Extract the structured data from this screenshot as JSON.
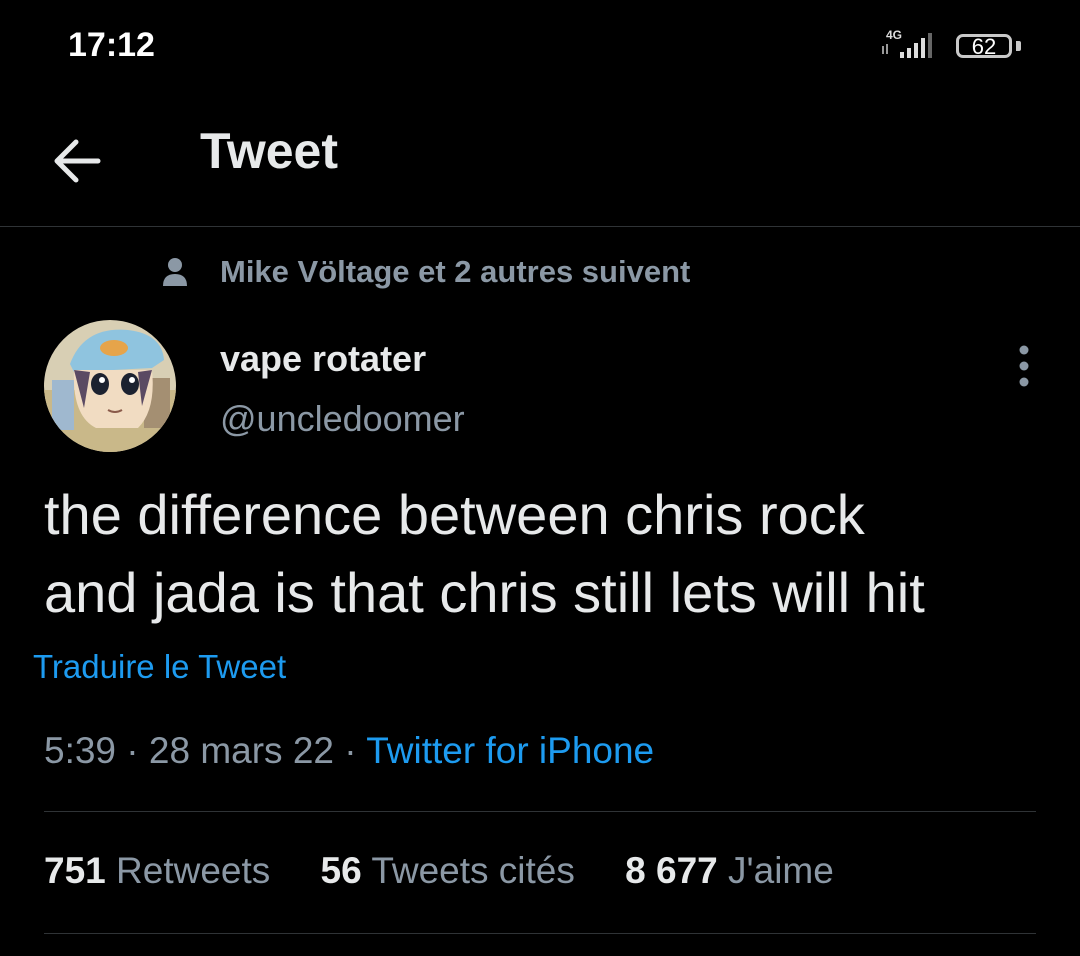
{
  "status_bar": {
    "time": "17:12",
    "network": "4G",
    "battery": "62",
    "icons": [
      "signal-icon",
      "battery-icon"
    ]
  },
  "header": {
    "title": "Tweet",
    "back_icon": "arrow-left-icon"
  },
  "tweet": {
    "social_context": "Mike Völtage et 2 autres suivent",
    "author_name": "vape rotater",
    "author_handle": "@uncledoomer",
    "text_line1": "the difference between chris rock",
    "text_line2": "and jada is that chris still lets will hit",
    "translate": "Traduire le Tweet",
    "time": "5:39",
    "sep1": " · ",
    "date": "28 mars 22",
    "sep2": " · ",
    "source": "Twitter for iPhone",
    "more_icon": "more-vertical-icon"
  },
  "stats": {
    "retweets_count": "751",
    "retweets_label": "Retweets",
    "quotes_count": "56",
    "quotes_label": "Tweets cités",
    "likes_count": "8 677",
    "likes_label": "J'aime"
  },
  "colors": {
    "background": "#000000",
    "text": "#e7e9ea",
    "secondary": "#8b98a5",
    "link": "#1d9bf0",
    "divider": "#2f3336"
  }
}
